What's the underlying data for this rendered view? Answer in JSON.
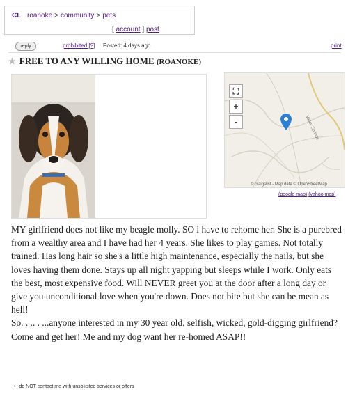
{
  "header": {
    "logo": "CL",
    "crumbs": [
      "roanoke",
      "community",
      "pets"
    ],
    "crumb_sep": ">",
    "account_open": "[",
    "account": "account",
    "account_close": "]",
    "post": "post"
  },
  "meta": {
    "reply": "reply",
    "prohibited": "prohibited",
    "prohibited_mark": "[?]",
    "posted": "Posted: 4 days ago",
    "print": "print"
  },
  "listing": {
    "title": "FREE TO ANY WILLING HOME",
    "location": "(ROANOKE)"
  },
  "map": {
    "zoom_fullscreen": "⛶",
    "zoom_in": "+",
    "zoom_out": "-",
    "credit": "© craigslist - Map data © OpenStreetMap",
    "google_map": "(google map)",
    "yahoo_map": "(yahoo map)",
    "road_label": "Valley Springs"
  },
  "body": {
    "paragraph1": "MY girlfriend does not like my beagle molly. SO i have to rehome her. She is a purebred from a wealthy area and I have had her 4 years. She likes to play games. Not totally trained. Has long hair so she's a little high maintenance, especially the nails, but she loves having them done. Stays up all night yapping but sleeps while I work. Only eats the best, most expensive food. Will NEVER greet you at the door after a long day or give you unconditional love when you're down. Does not bite but she can be mean as hell!",
    "paragraph2": "So. . .. . ...anyone interested in my 30 year old, selfish, wicked, gold-digging girlfriend? Come and get her! Me and my dog want her re-homed ASAP!!"
  },
  "notice": "do NOT contact me with unsolicited services or offers",
  "colors": {
    "link": "#551a8b",
    "map_pin": "#2b7fd4",
    "map_bg": "#f2efe9"
  }
}
